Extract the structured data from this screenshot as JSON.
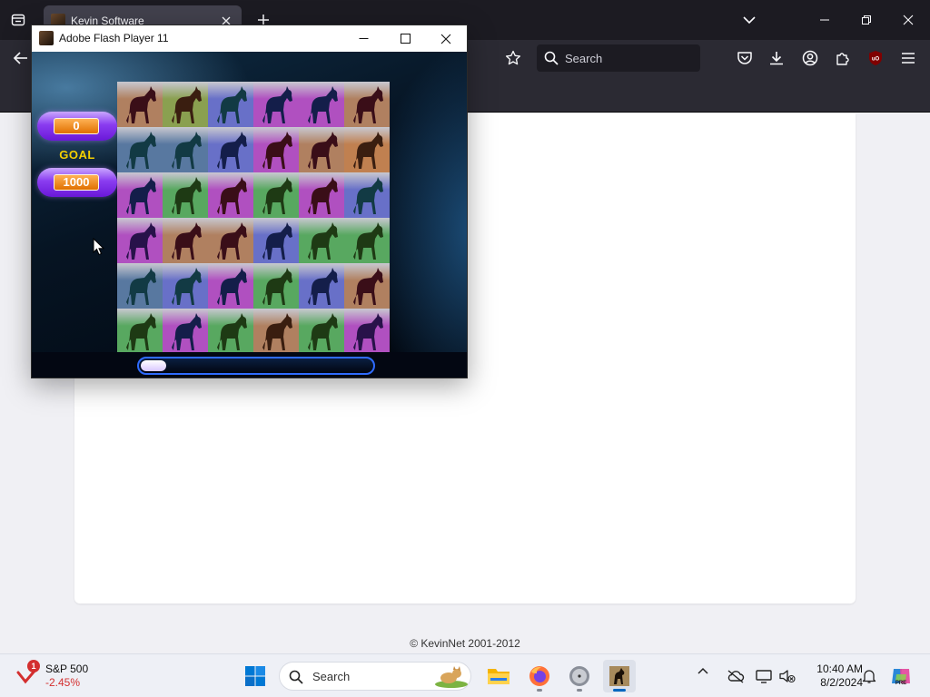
{
  "browser": {
    "tab_title": "Kevin Software",
    "search_placeholder": "Search"
  },
  "flash_window": {
    "title": "Adobe Flash Player 11",
    "game": {
      "score": "0",
      "goal_label": "GOAL",
      "goal": "1000",
      "progress_fraction": 0.11,
      "board": {
        "rows": 6,
        "cols": 6,
        "tile_backgrounds": {
          "brown": "#b08060",
          "olive": "#8aa050",
          "blue": "#6870c8",
          "magenta": "#b050c0",
          "teal": "#5878a0",
          "green": "#58a860",
          "lavender": "#9890d8",
          "orange": "#c08050"
        },
        "horse_colors": {
          "black": "#1a1014",
          "green": "#1e3a14",
          "navy": "#141e4a",
          "teal": "#123a44",
          "maroon": "#3a0e18",
          "brown": "#3a1e10",
          "purple": "#28124a"
        },
        "tiles": [
          [
            {
              "bg": "brown",
              "horse": "maroon"
            },
            {
              "bg": "olive",
              "horse": "brown"
            },
            {
              "bg": "blue",
              "horse": "teal"
            },
            {
              "bg": "magenta",
              "horse": "navy"
            },
            {
              "bg": "magenta",
              "horse": "navy"
            },
            {
              "bg": "brown",
              "horse": "maroon"
            }
          ],
          [
            {
              "bg": "teal",
              "horse": "teal"
            },
            {
              "bg": "teal",
              "horse": "teal"
            },
            {
              "bg": "blue",
              "horse": "navy"
            },
            {
              "bg": "magenta",
              "horse": "maroon"
            },
            {
              "bg": "brown",
              "horse": "maroon"
            },
            {
              "bg": "orange",
              "horse": "brown"
            }
          ],
          [
            {
              "bg": "magenta",
              "horse": "navy"
            },
            {
              "bg": "green",
              "horse": "green"
            },
            {
              "bg": "magenta",
              "horse": "maroon"
            },
            {
              "bg": "green",
              "horse": "green"
            },
            {
              "bg": "magenta",
              "horse": "maroon"
            },
            {
              "bg": "blue",
              "horse": "teal"
            }
          ],
          [
            {
              "bg": "magenta",
              "horse": "purple"
            },
            {
              "bg": "brown",
              "horse": "maroon"
            },
            {
              "bg": "brown",
              "horse": "maroon"
            },
            {
              "bg": "blue",
              "horse": "navy"
            },
            {
              "bg": "green",
              "horse": "green"
            },
            {
              "bg": "green",
              "horse": "green"
            }
          ],
          [
            {
              "bg": "teal",
              "horse": "teal"
            },
            {
              "bg": "blue",
              "horse": "teal"
            },
            {
              "bg": "magenta",
              "horse": "navy"
            },
            {
              "bg": "green",
              "horse": "green"
            },
            {
              "bg": "blue",
              "horse": "navy"
            },
            {
              "bg": "brown",
              "horse": "maroon"
            }
          ],
          [
            {
              "bg": "green",
              "horse": "green"
            },
            {
              "bg": "magenta",
              "horse": "navy"
            },
            {
              "bg": "green",
              "horse": "green"
            },
            {
              "bg": "brown",
              "horse": "brown"
            },
            {
              "bg": "green",
              "horse": "green"
            },
            {
              "bg": "magenta",
              "horse": "purple"
            }
          ]
        ]
      }
    }
  },
  "page": {
    "copyright": "© KevinNet 2001-2012"
  },
  "taskbar": {
    "stock_name": "S&P 500",
    "stock_change": "-2.45%",
    "stock_badge": "1",
    "search_label": "Search",
    "clock_time": "10:40 AM",
    "clock_date": "8/2/2024"
  },
  "colors": {
    "accent_blue": "#0067c0",
    "pill_purple": "#8a3cf0",
    "score_orange": "#e07000",
    "goal_yellow": "#f5d000",
    "stock_red": "#d32f2f"
  }
}
